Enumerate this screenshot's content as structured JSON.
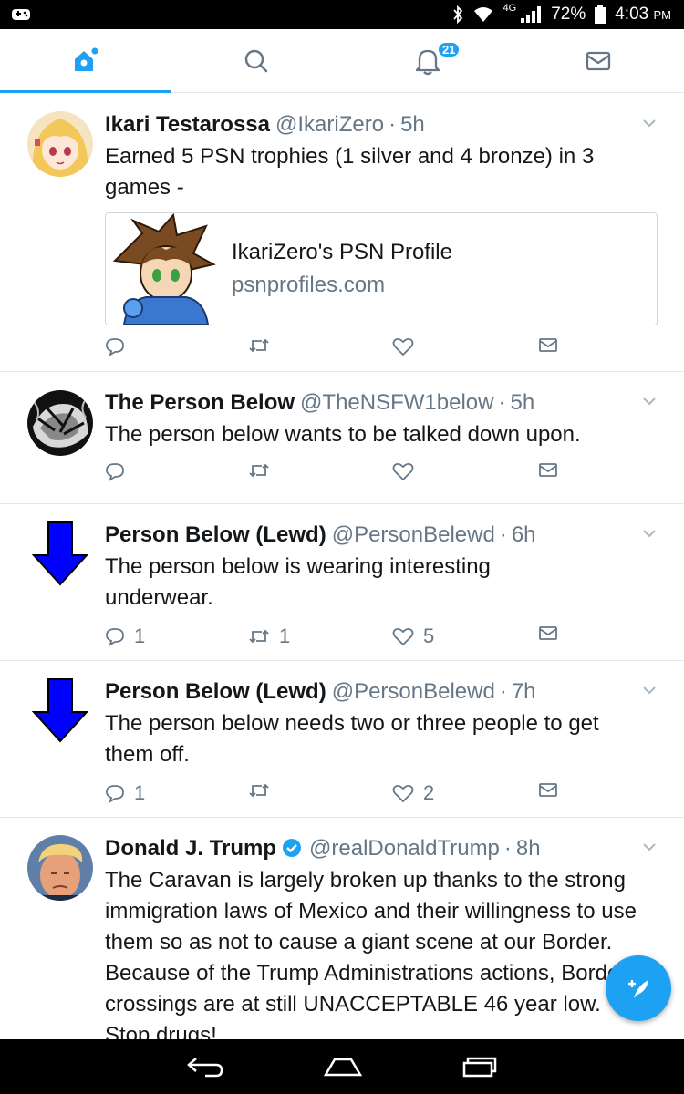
{
  "status_bar": {
    "network": "4G",
    "battery": "72%",
    "time": "4:03",
    "ampm": "PM"
  },
  "nav": {
    "tabs": [
      {
        "name": "home",
        "icon": "home-icon",
        "active": true
      },
      {
        "name": "search",
        "icon": "search-icon",
        "active": false
      },
      {
        "name": "notifications",
        "icon": "bell-icon",
        "active": false,
        "badge": "21"
      },
      {
        "name": "messages",
        "icon": "envelope-icon",
        "active": false
      }
    ]
  },
  "tweets": [
    {
      "name": "Ikari Testarossa",
      "handle": "@IkariZero",
      "time": "5h",
      "text": "Earned 5 PSN trophies (1 silver and 4 bronze) in 3 games -",
      "card": {
        "title": "IkariZero's PSN Profile",
        "domain": "psnprofiles.com"
      },
      "replies": "",
      "retweets": "",
      "likes": ""
    },
    {
      "name": "The Person Below",
      "handle": "@TheNSFW1below",
      "time": "5h",
      "text": "The person below wants to be talked down upon.",
      "replies": "",
      "retweets": "",
      "likes": ""
    },
    {
      "name": "Person Below (Lewd)",
      "handle": "@PersonBelewd",
      "time": "6h",
      "text": "The person below is wearing interesting underwear.",
      "replies": "1",
      "retweets": "1",
      "likes": "5"
    },
    {
      "name": "Person Below (Lewd)",
      "handle": "@PersonBelewd",
      "time": "7h",
      "text": "The person below needs two or three people to get them off.",
      "replies": "1",
      "retweets": "",
      "likes": "2"
    },
    {
      "name": "Donald J. Trump",
      "handle": "@realDonaldTrump",
      "time": "8h",
      "verified": true,
      "text": "The Caravan is largely broken up thanks to the strong immigration laws of Mexico and their willingness to use them so as not to cause a giant scene at our Border. Because of the Trump Administrations actions, Border crossings are at still UNACCEPTABLE 46 year low. Stop drugs!"
    }
  ],
  "separator": "·",
  "colors": {
    "accent": "#1da1f2",
    "secondary_text": "#657786",
    "arrow_blue": "#0000ff"
  }
}
